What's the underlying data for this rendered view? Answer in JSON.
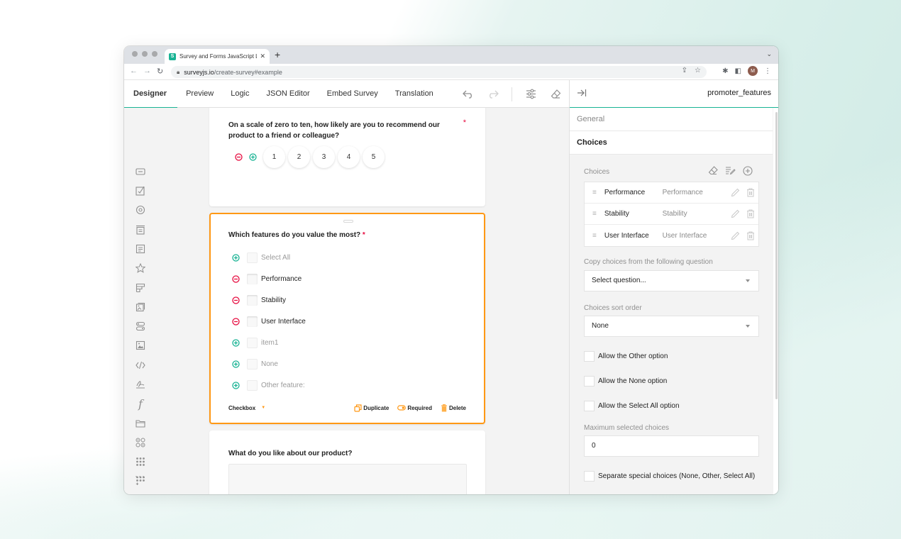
{
  "browser": {
    "tab_title": "Survey and Forms JavaScript L",
    "favicon_letter": "S",
    "url_host": "surveyjs.io",
    "url_path": "/create-survey#example",
    "profile_initial": "M"
  },
  "creator": {
    "tabs": [
      {
        "label": "Designer",
        "active": true
      },
      {
        "label": "Preview",
        "active": false
      },
      {
        "label": "Logic",
        "active": false
      },
      {
        "label": "JSON Editor",
        "active": false
      },
      {
        "label": "Embed Survey",
        "active": false
      },
      {
        "label": "Translation",
        "active": false
      }
    ],
    "toolbar_icons": [
      "undo-icon",
      "redo-icon",
      "settings-icon",
      "clear-icon"
    ],
    "selected_object_name": "promoter_features"
  },
  "toolbox": {
    "items": [
      "single-input-icon",
      "checkbox-icon",
      "radiogroup-icon",
      "dropdown-icon",
      "comment-icon",
      "rating-icon",
      "ranking-icon",
      "imagepicker-icon",
      "boolean-icon",
      "image-icon",
      "html-icon",
      "signaturepad-icon",
      "expression-icon",
      "file-icon",
      "matrix-icon",
      "matrix-dropdown-icon",
      "matrix-dynamic-icon",
      "multiple-text-icon",
      "more-icon"
    ]
  },
  "surface": {
    "q1": {
      "title": "On a scale of zero to ten, how likely are you to recommend our product to a friend or colleague?",
      "required_mark": "*",
      "rate_values": [
        "1",
        "2",
        "3",
        "4",
        "5"
      ]
    },
    "q2": {
      "title": "Which features do you value the most?",
      "required_mark": "*",
      "choices": [
        {
          "label": "Select All",
          "state": "inactive"
        },
        {
          "label": "Performance",
          "state": "active"
        },
        {
          "label": "Stability",
          "state": "active"
        },
        {
          "label": "User Interface",
          "state": "active"
        },
        {
          "label": "item1",
          "state": "inactive"
        },
        {
          "label": "None",
          "state": "inactive"
        },
        {
          "label": "Other feature:",
          "state": "inactive"
        }
      ],
      "type_label": "Checkbox",
      "actions": {
        "duplicate": "Duplicate",
        "required": "Required",
        "delete": "Delete"
      }
    },
    "q3": {
      "title": "What do you like about our product?"
    }
  },
  "property_grid": {
    "categories": {
      "general": "General",
      "choices": "Choices"
    },
    "choices_label": "Choices",
    "choices": [
      {
        "value": "Performance",
        "text": "Performance"
      },
      {
        "value": "Stability",
        "text": "Stability"
      },
      {
        "value": "User Interface",
        "text": "User Interface"
      }
    ],
    "copy_choices_label": "Copy choices from the following question",
    "copy_choices_value": "Select question...",
    "sort_order_label": "Choices sort order",
    "sort_order_value": "None",
    "allow_other_label": "Allow the Other option",
    "allow_none_label": "Allow the None option",
    "allow_select_all_label": "Allow the Select All option",
    "max_selected_label": "Maximum selected choices",
    "max_selected_value": "0",
    "separate_special_label": "Separate special choices (None, Other, Select All)"
  },
  "colors": {
    "accent": "#19b394",
    "selection": "#ff9814",
    "required": "#e60a3e"
  }
}
